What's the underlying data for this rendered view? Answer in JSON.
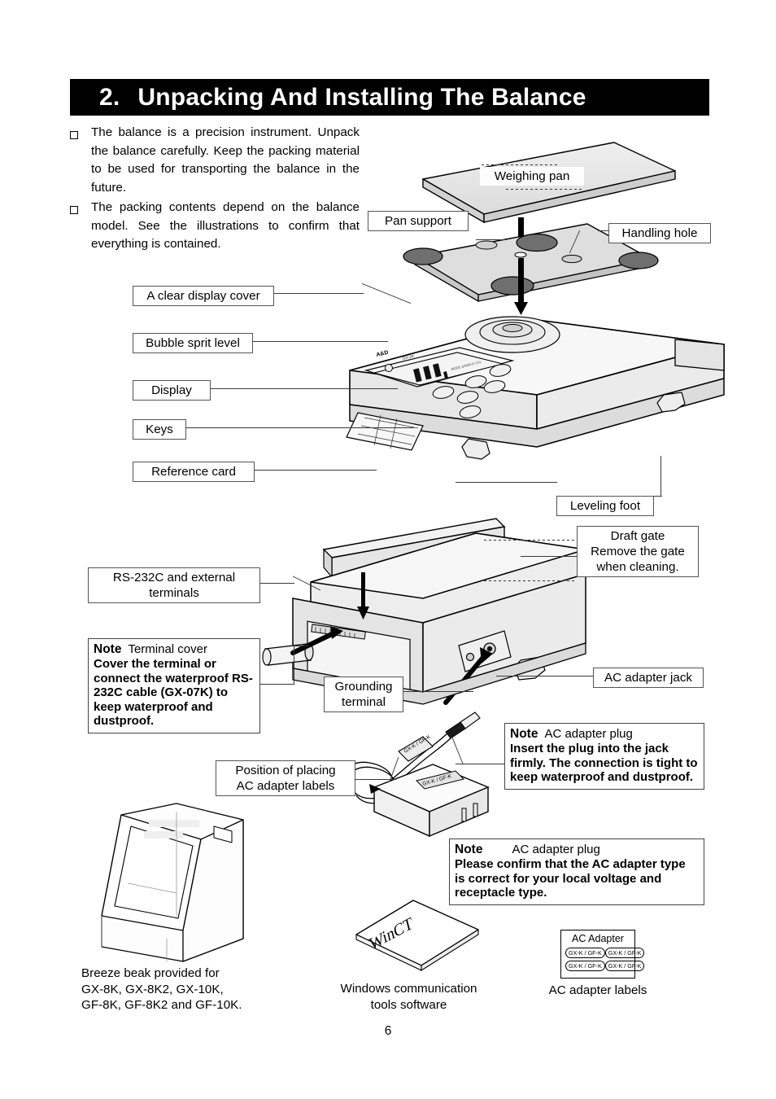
{
  "header": {
    "number": "2.",
    "title": "Unpacking And Installing The Balance"
  },
  "intro": {
    "bullets": [
      "The balance is a precision instrument. Unpack the balance carefully. Keep the packing material to be used for transporting the balance in the future.",
      "The packing contents depend on the balance model. See the illustrations to confirm that everything is contained."
    ]
  },
  "top_diagram": {
    "labels": {
      "weighing_pan": "Weighing pan",
      "pan_support": "Pan support",
      "handling_hole": "Handling hole",
      "display_cover": "A clear display cover",
      "bubble_level": "Bubble sprit level",
      "display": "Display",
      "keys": "Keys",
      "reference_card": "Reference card",
      "leveling_foot": "Leveling foot"
    }
  },
  "middle_diagram": {
    "labels": {
      "draft_gate": "Draft gate\nRemove the gate\nwhen cleaning.",
      "rs232c": "RS-232C and external\nterminals",
      "terminal_cover": "Terminal cover",
      "grounding_terminal": "Grounding\nterminal",
      "ac_adapter_jack": "AC adapter jack",
      "ac_adapter_plug": "AC adapter plug",
      "label_position": "Position of placing\nAC adapter labels"
    },
    "notes": [
      {
        "title": "Note",
        "subtitle": "Terminal cover",
        "body": "Cover the terminal or connect the waterproof RS-232C cable (GX-07K) to keep waterproof and dustproof."
      },
      {
        "title": "Note",
        "subtitle": "AC adapter plug",
        "body": "Insert the plug into the jack firmly. The connection is tight to keep waterproof and dustproof."
      },
      {
        "title": "Note",
        "subtitle": "AC adapter plug",
        "body": "Please confirm that the AC adapter type is correct for your local voltage and receptacle type."
      }
    ]
  },
  "bottom": {
    "breeze_break_caption": "Breeze beak provided for\nGX-8K, GX-8K2, GX-10K,\nGF-8K, GF-8K2 and GF-10K.",
    "winct_caption": "Windows communication\ntools software",
    "winct_disc_text": "WinCT",
    "ac_labels_caption": "AC adapter labels",
    "ac_label_sheet": {
      "title": "AC Adapter",
      "chips": [
        "GX-K / GF-K",
        "GX-K / GF-K",
        "GX-K / GF-K",
        "GX-K / GF-K"
      ]
    }
  },
  "page_number": "6",
  "colors": {
    "bar_bg": "#000000",
    "bar_text": "#ffffff",
    "body_text": "#000000",
    "box_border": "#555555",
    "art_fill": "#e8e8e8",
    "art_line": "#000000"
  }
}
